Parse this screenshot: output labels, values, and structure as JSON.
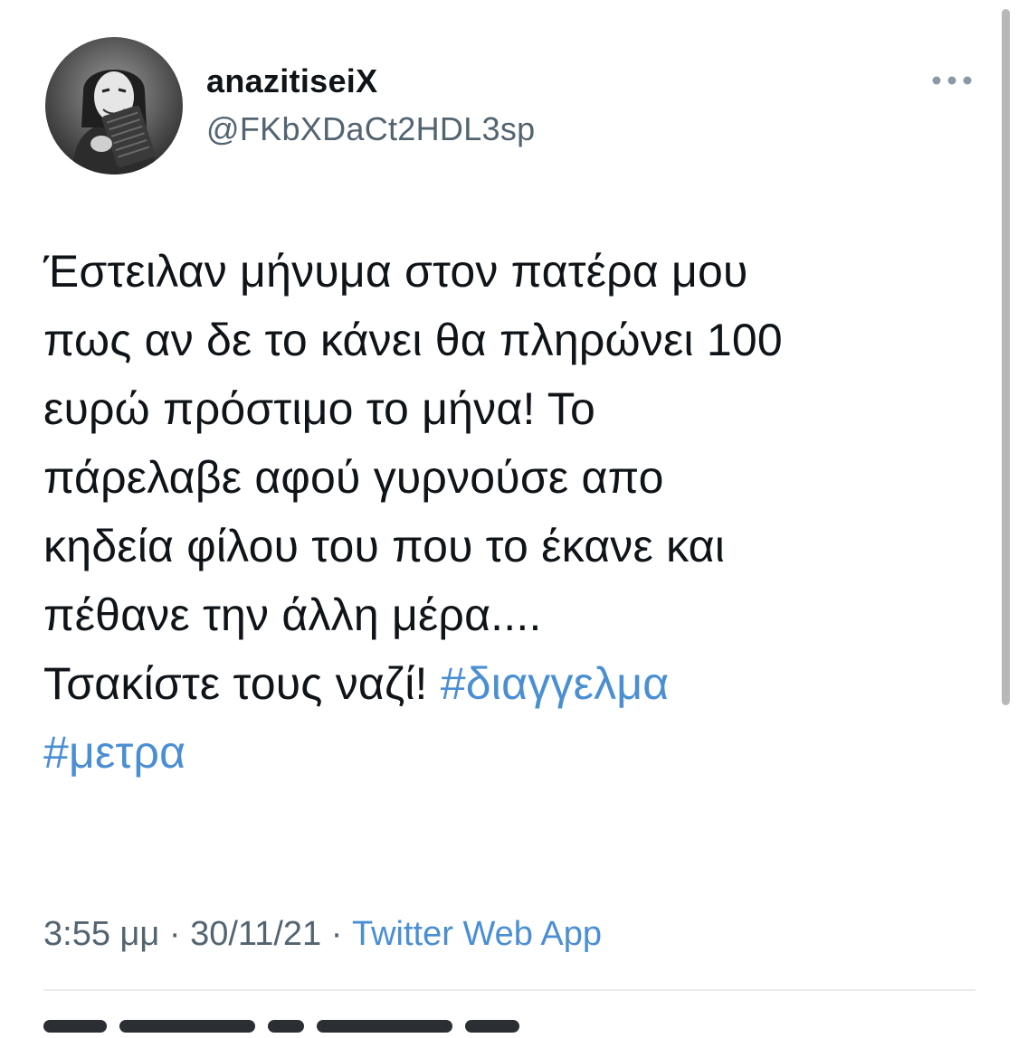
{
  "tweet": {
    "author": {
      "display_name": "anazitiseiX",
      "handle": "@FKbXDaCt2HDL3sp"
    },
    "text_lines": [
      "Έστειλαν μήνυμα στον πατέρα μου",
      "πως αν δε το κάνει θα πληρώνει 100",
      "ευρώ πρόστιμο το μήνα! Το",
      "πάρελαβε αφού γυρνούσε απο",
      "κηδεία φίλου του που το έκανε και",
      "πέθανε την άλλη μέρα....",
      "Τσακίστε τους ναζί! "
    ],
    "hashtags": [
      "#διαγγελμα",
      "#μετρα"
    ],
    "time": "3:55 μμ",
    "separator": " · ",
    "date": "30/11/21",
    "source": "Twitter Web App"
  },
  "icons": {
    "more": "more-horizontal-icon",
    "avatar": "avatar-image"
  },
  "colors": {
    "text": "#0f1419",
    "secondary": "#536471",
    "link": "#4a8ed3",
    "divider": "#e9ecef"
  }
}
